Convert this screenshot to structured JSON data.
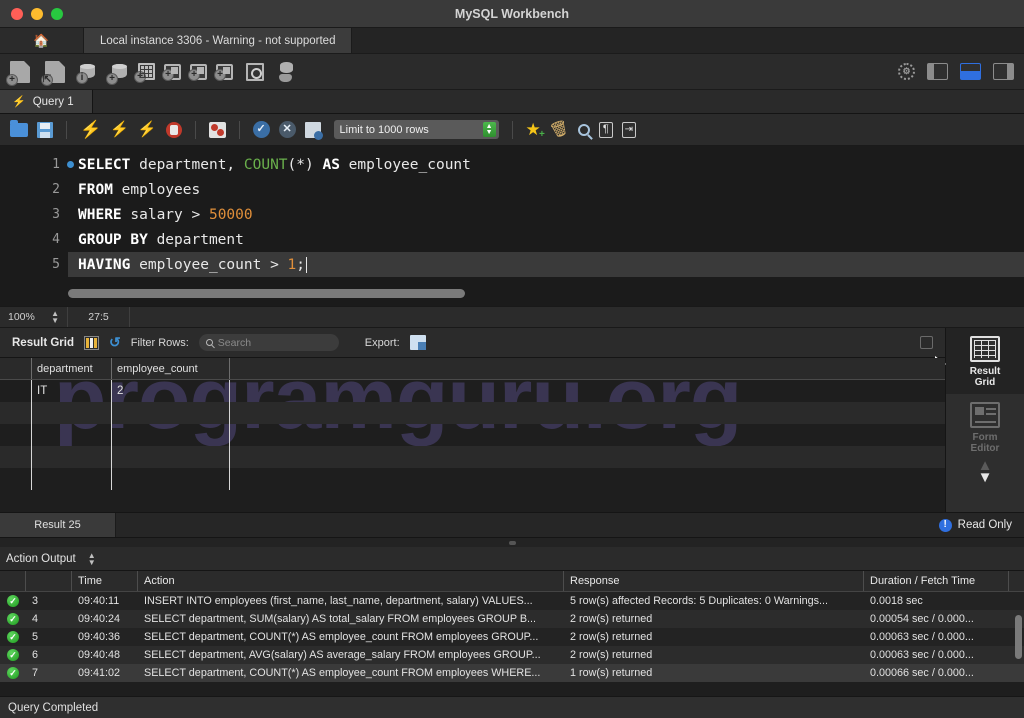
{
  "window": {
    "title": "MySQL Workbench",
    "traffic_lights": [
      "close",
      "minimize",
      "maximize"
    ]
  },
  "instance_bar": {
    "home_icon": "home-icon",
    "instance_tab_label": "Local instance 3306 - Warning - not supported"
  },
  "main_toolbar": {
    "icons": [
      "new-sql-file-icon",
      "open-sql-file-icon",
      "inspector-icon",
      "new-schema-icon",
      "new-table-icon",
      "new-view-icon",
      "new-procedure-icon",
      "new-function-icon",
      "search-data-icon",
      "reconnect-dbms-icon"
    ],
    "right_icons": [
      "settings-gear-icon",
      "toggle-left-panel",
      "toggle-bottom-panel",
      "toggle-right-panel"
    ]
  },
  "query_tab": {
    "label": "Query 1",
    "icon": "lightning-bolt-icon"
  },
  "query_toolbar": {
    "icons": [
      "open-file-icon",
      "save-file-icon",
      "execute-statement-icon",
      "execute-current-statement-icon",
      "explain-query-icon",
      "stop-execution-icon",
      "toggle-stop-on-error-icon",
      "commit-icon",
      "rollback-icon",
      "toggle-autocommit-icon"
    ],
    "limit_select_value": "Limit to 1000 rows",
    "right_icons": [
      "beautify-sql-icon",
      "clear-context-icon",
      "find-icon",
      "toggle-invisible-chars-icon",
      "toggle-word-wrap-icon"
    ]
  },
  "editor": {
    "lines": [
      {
        "number": "1",
        "has_breakpoint_dot": true
      },
      {
        "number": "2",
        "has_breakpoint_dot": false
      },
      {
        "number": "3",
        "has_breakpoint_dot": false
      },
      {
        "number": "4",
        "has_breakpoint_dot": false
      },
      {
        "number": "5",
        "has_breakpoint_dot": false
      }
    ],
    "code": {
      "l1_kw": "SELECT",
      "l1_mid": " department, ",
      "l1_fn": "COUNT",
      "l1_args": "(*) ",
      "l1_as": "AS",
      "l1_alias": " employee_count",
      "l2_kw": "FROM",
      "l2_rest": " employees",
      "l3_kw": "WHERE",
      "l3_mid": " salary > ",
      "l3_num": "50000",
      "l4_kw": "GROUP BY",
      "l4_rest": " department",
      "l5_kw": "HAVING",
      "l5_mid": " employee_count > ",
      "l5_num": "1",
      "l5_end": ";"
    },
    "status": {
      "zoom": "100%",
      "cursor_position": "27:5"
    }
  },
  "result_panel": {
    "toolbar": {
      "title": "Result Grid",
      "columns_icon": "toggle-columns-icon",
      "refresh_icon": "refresh-icon",
      "filter_label": "Filter Rows:",
      "search_placeholder": "Search",
      "export_label": "Export:",
      "export_icon": "export-recordset-icon"
    },
    "watermark": "programguru.org",
    "grid": {
      "columns": [
        "department",
        "employee_count"
      ],
      "rows": [
        {
          "department": "IT",
          "employee_count": "2"
        }
      ]
    },
    "side_tabs": [
      {
        "label_line1": "Result",
        "label_line2": "Grid",
        "icon": "result-grid-icon",
        "active": true
      },
      {
        "label_line1": "Form",
        "label_line2": "Editor",
        "icon": "form-editor-icon",
        "active": false
      }
    ]
  },
  "result_tabbar": {
    "tab_label": "Result 25",
    "readonly_label": "Read Only",
    "readonly_icon": "info-icon"
  },
  "action_output": {
    "header_label": "Action Output",
    "columns": [
      "",
      "",
      "Time",
      "Action",
      "Response",
      "Duration / Fetch Time"
    ],
    "rows": [
      {
        "status": "success",
        "num": "3",
        "time": "09:40:11",
        "action": "INSERT INTO employees (first_name, last_name, department, salary) VALUES...",
        "response": "5 row(s) affected Records: 5  Duplicates: 0  Warnings...",
        "duration": "0.0018 sec"
      },
      {
        "status": "success",
        "num": "4",
        "time": "09:40:24",
        "action": "SELECT department, SUM(salary) AS total_salary FROM employees GROUP B...",
        "response": "2 row(s) returned",
        "duration": "0.00054 sec / 0.000..."
      },
      {
        "status": "success",
        "num": "5",
        "time": "09:40:36",
        "action": "SELECT department, COUNT(*) AS employee_count FROM employees GROUP...",
        "response": "2 row(s) returned",
        "duration": "0.00063 sec / 0.000..."
      },
      {
        "status": "success",
        "num": "6",
        "time": "09:40:48",
        "action": "SELECT department, AVG(salary) AS average_salary FROM employees GROUP...",
        "response": "2 row(s) returned",
        "duration": "0.00063 sec / 0.000..."
      },
      {
        "status": "success",
        "num": "7",
        "time": "09:41:02",
        "action": "SELECT department, COUNT(*) AS employee_count FROM employees WHERE...",
        "response": "1 row(s) returned",
        "duration": "0.00066 sec / 0.000..."
      }
    ]
  },
  "bottom_status": {
    "text": "Query Completed"
  },
  "colors": {
    "accent_blue": "#2f6fe0",
    "success_green": "#1f9b1f",
    "keyword_white": "#ffffff",
    "function_green": "#6ab04c",
    "number_orange": "#e08f3a",
    "watermark": "#3a3552"
  }
}
